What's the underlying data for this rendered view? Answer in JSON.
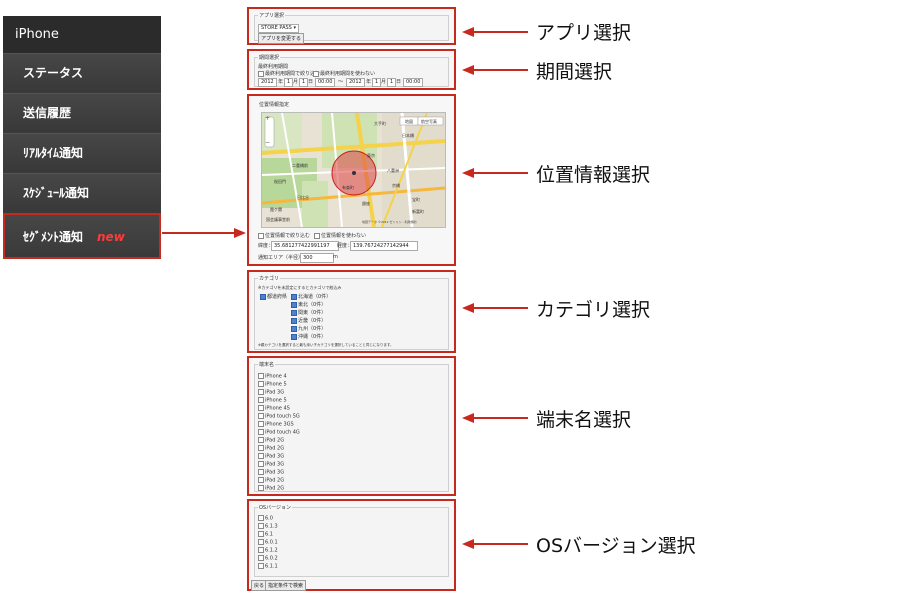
{
  "sidebar": {
    "title": "iPhone",
    "items": [
      {
        "label": "ステータス"
      },
      {
        "label": "送信履歴"
      },
      {
        "label": "ﾘｱﾙﾀｲﾑ通知"
      },
      {
        "label": "ｽｹｼﾞｭｰﾙ通知"
      },
      {
        "label": "ｾｸﾞﾒﾝﾄ通知",
        "badge": "new"
      }
    ]
  },
  "app_panel": {
    "legend": "アプリ選択",
    "select_value": "STORE PASS",
    "button_label": "アプリを変更する"
  },
  "period_panel": {
    "legend": "期間選択",
    "caption": "最終利用期間",
    "opt_filter": "最終利用期間で絞り込む",
    "opt_no_filter": "最終利用期間を使わない",
    "start": {
      "year": "2012",
      "month": "1",
      "day": "1",
      "time": "00:00"
    },
    "year_label": "年",
    "month_label": "月",
    "day_label": "日",
    "separator": "〜",
    "end": {
      "year": "2012",
      "month": "1",
      "day": "1",
      "time": "00:00"
    }
  },
  "location_panel": {
    "legend": "位置情報指定",
    "map_type_map": "地図",
    "map_type_sat": "航空写真",
    "map_labels": [
      "大手町",
      "二重橋前",
      "東京",
      "日比谷",
      "有楽町",
      "銀座",
      "京橋",
      "八重洲",
      "宝町",
      "新富町",
      "霞ケ関",
      "桜田門",
      "国会議事堂前",
      "日本橋"
    ],
    "copyright": "地図データ ©2012 ゼンリン - 利用規約",
    "opt_filter": "位置情報で絞り込む",
    "opt_no_filter": "位置情報を使わない",
    "lat_label": "緯度：",
    "lat_value": "35.681277422991197",
    "lng_label": "経度：",
    "lng_value": "139.76724277142944",
    "radius_label": "通知エリア（半径）：",
    "radius_value": "300",
    "radius_unit": "m"
  },
  "category_panel": {
    "legend": "カテゴリ",
    "caption": "※カテゴリを未設定にするとカテゴリで絞込み",
    "all_label": "都道府県",
    "items": [
      "北海道（0件）",
      "東北（0件）",
      "関東（0件）",
      "近畿（0件）",
      "九州（0件）",
      "沖縄（0件）"
    ],
    "note": "※親カテゴリを選択すると最も深い子カテゴリを選択していることと同じになります。"
  },
  "device_panel": {
    "legend": "端末名",
    "items": [
      "iPhone 4",
      "iPhone 5",
      "iPad 3G",
      "iPhone 5",
      "iPhone 4S",
      "iPod touch 5G",
      "iPhone 3GS",
      "iPod touch 4G",
      "iPad 2G",
      "iPad 2G",
      "iPad 3G",
      "iPad 3G",
      "iPad 3G",
      "iPad 2G",
      "iPad 2G"
    ]
  },
  "os_panel": {
    "legend": "OSバージョン",
    "items": [
      "6.0",
      "6.1.3",
      "6.1",
      "6.0.1",
      "6.1.2",
      "6.0.2",
      "6.1.1"
    ],
    "back_button": "戻る",
    "search_button": "指定条件で検索"
  },
  "callouts": [
    "アプリ選択",
    "期間選択",
    "位置情報選択",
    "カテゴリ選択",
    "端末名選択",
    "OSバージョン選択"
  ],
  "colors": {
    "annotation_red": "#c8291f",
    "sidebar_bg": "#3a3a3a",
    "new_badge": "#ff3b3b"
  }
}
